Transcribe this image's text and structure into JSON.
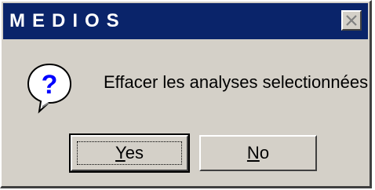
{
  "window": {
    "title": "MEDIOS",
    "close_icon": "close-icon"
  },
  "dialog": {
    "icon": "question-icon",
    "message": "Effacer les analyses selectionnées"
  },
  "buttons": {
    "yes_mnemonic": "Y",
    "yes_rest": "es",
    "no_mnemonic": "N",
    "no_rest": "o"
  },
  "colors": {
    "titlebar": "#0a246a",
    "face": "#d4d0c8"
  }
}
